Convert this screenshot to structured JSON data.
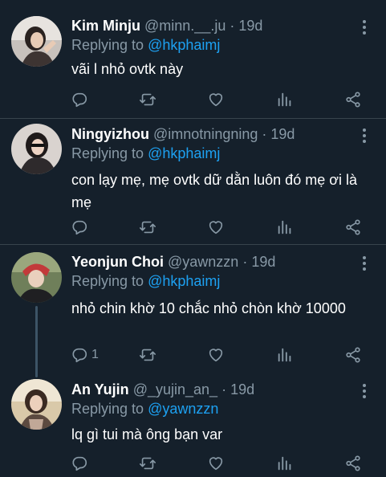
{
  "tweets": [
    {
      "name": "Kim Minju",
      "handle": "@minn.__.ju",
      "dot": "·",
      "time": "19d",
      "replying_prefix": "Replying to ",
      "replying_to": "@hkphaimj",
      "text": "vãi l nhỏ ovtk này",
      "reply_count": ""
    },
    {
      "name": "Ningyizhou",
      "handle": "@imnotningning",
      "dot": "·",
      "time": "19d",
      "replying_prefix": "Replying to ",
      "replying_to": "@hkphaimj",
      "text": "con lạy mẹ, mẹ ovtk dữ dằn luôn đó mẹ ơi là mẹ",
      "reply_count": ""
    },
    {
      "name": "Yeonjun Choi",
      "handle": "@yawnzzn",
      "dot": "·",
      "time": "19d",
      "replying_prefix": "Replying to ",
      "replying_to": "@hkphaimj",
      "text": "nhỏ chin khờ 10 chắc nhỏ chòn khờ 10000",
      "reply_count": "1"
    },
    {
      "name": "An Yujin",
      "handle": "@_yujin_an_",
      "dot": "·",
      "time": "19d",
      "replying_prefix": "Replying to ",
      "replying_to": "@yawnzzn",
      "text": "lq gì tui mà ông bạn var",
      "reply_count": ""
    }
  ],
  "icons": {
    "reply": "reply-icon",
    "retweet": "retweet-icon",
    "like": "like-icon",
    "analytics": "analytics-icon",
    "share": "share-icon",
    "more": "more-icon"
  },
  "colors": {
    "background": "#15202b",
    "secondary_text": "#8899a6",
    "accent": "#1da1f2",
    "divider": "#38444d"
  }
}
